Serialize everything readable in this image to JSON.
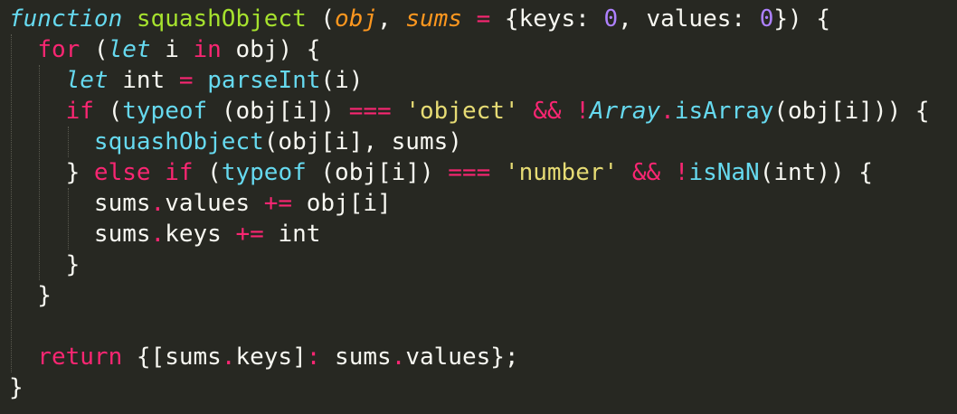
{
  "colors": {
    "background": "#272822",
    "foreground": "#f8f8f2",
    "keyword": "#f92672",
    "storage": "#66d9ef",
    "function_name": "#a6e22e",
    "parameter": "#fd971f",
    "string": "#e6db74",
    "number": "#ae81ff",
    "indent_guide": "#5a5a50"
  },
  "code_lines": [
    [
      {
        "t": "function",
        "c": "st"
      },
      {
        "t": " ",
        "c": "pl"
      },
      {
        "t": "squashObject",
        "c": "fn"
      },
      {
        "t": " (",
        "c": "pl"
      },
      {
        "t": "obj",
        "c": "par"
      },
      {
        "t": ", ",
        "c": "pl"
      },
      {
        "t": "sums",
        "c": "par"
      },
      {
        "t": " ",
        "c": "pl"
      },
      {
        "t": "=",
        "c": "op"
      },
      {
        "t": " {keys: ",
        "c": "pl"
      },
      {
        "t": "0",
        "c": "num"
      },
      {
        "t": ", values: ",
        "c": "pl"
      },
      {
        "t": "0",
        "c": "num"
      },
      {
        "t": "}) {",
        "c": "pl"
      }
    ],
    [
      {
        "t": "  ",
        "c": "pl"
      },
      {
        "t": "for",
        "c": "kw"
      },
      {
        "t": " (",
        "c": "pl"
      },
      {
        "t": "let",
        "c": "st"
      },
      {
        "t": " i ",
        "c": "pl"
      },
      {
        "t": "in",
        "c": "kw"
      },
      {
        "t": " obj) {",
        "c": "pl"
      }
    ],
    [
      {
        "t": "    ",
        "c": "pl"
      },
      {
        "t": "let",
        "c": "st"
      },
      {
        "t": " int ",
        "c": "pl"
      },
      {
        "t": "=",
        "c": "op"
      },
      {
        "t": " ",
        "c": "pl"
      },
      {
        "t": "parseInt",
        "c": "blt"
      },
      {
        "t": "(i)",
        "c": "pl"
      }
    ],
    [
      {
        "t": "    ",
        "c": "pl"
      },
      {
        "t": "if",
        "c": "kw"
      },
      {
        "t": " (",
        "c": "pl"
      },
      {
        "t": "typeof",
        "c": "blt"
      },
      {
        "t": " (obj[i]) ",
        "c": "pl"
      },
      {
        "t": "===",
        "c": "op"
      },
      {
        "t": " ",
        "c": "pl"
      },
      {
        "t": "'object'",
        "c": "str"
      },
      {
        "t": " ",
        "c": "pl"
      },
      {
        "t": "&&",
        "c": "op"
      },
      {
        "t": " ",
        "c": "pl"
      },
      {
        "t": "!",
        "c": "op"
      },
      {
        "t": "Array",
        "c": "st"
      },
      {
        "t": ".",
        "c": "op"
      },
      {
        "t": "isArray",
        "c": "blt"
      },
      {
        "t": "(obj[i])) {",
        "c": "pl"
      }
    ],
    [
      {
        "t": "      ",
        "c": "pl"
      },
      {
        "t": "squashObject",
        "c": "blt"
      },
      {
        "t": "(obj[i], sums)",
        "c": "pl"
      }
    ],
    [
      {
        "t": "    } ",
        "c": "pl"
      },
      {
        "t": "else",
        "c": "kw"
      },
      {
        "t": " ",
        "c": "pl"
      },
      {
        "t": "if",
        "c": "kw"
      },
      {
        "t": " (",
        "c": "pl"
      },
      {
        "t": "typeof",
        "c": "blt"
      },
      {
        "t": " (obj[i]) ",
        "c": "pl"
      },
      {
        "t": "===",
        "c": "op"
      },
      {
        "t": " ",
        "c": "pl"
      },
      {
        "t": "'number'",
        "c": "str"
      },
      {
        "t": " ",
        "c": "pl"
      },
      {
        "t": "&&",
        "c": "op"
      },
      {
        "t": " ",
        "c": "pl"
      },
      {
        "t": "!",
        "c": "op"
      },
      {
        "t": "isNaN",
        "c": "blt"
      },
      {
        "t": "(int)) {",
        "c": "pl"
      }
    ],
    [
      {
        "t": "      sums",
        "c": "pl"
      },
      {
        "t": ".",
        "c": "op"
      },
      {
        "t": "values ",
        "c": "pl"
      },
      {
        "t": "+=",
        "c": "op"
      },
      {
        "t": " obj[i]",
        "c": "pl"
      }
    ],
    [
      {
        "t": "      sums",
        "c": "pl"
      },
      {
        "t": ".",
        "c": "op"
      },
      {
        "t": "keys ",
        "c": "pl"
      },
      {
        "t": "+=",
        "c": "op"
      },
      {
        "t": " int",
        "c": "pl"
      }
    ],
    [
      {
        "t": "    }",
        "c": "pl"
      }
    ],
    [
      {
        "t": "  }",
        "c": "pl"
      }
    ],
    [
      {
        "t": "",
        "c": "pl"
      }
    ],
    [
      {
        "t": "  ",
        "c": "pl"
      },
      {
        "t": "return",
        "c": "kw"
      },
      {
        "t": " {[sums",
        "c": "pl"
      },
      {
        "t": ".",
        "c": "op"
      },
      {
        "t": "keys]",
        "c": "pl"
      },
      {
        "t": ":",
        "c": "op"
      },
      {
        "t": " sums",
        "c": "pl"
      },
      {
        "t": ".",
        "c": "op"
      },
      {
        "t": "values};",
        "c": "pl"
      }
    ],
    [
      {
        "t": "}",
        "c": "pl"
      }
    ]
  ]
}
